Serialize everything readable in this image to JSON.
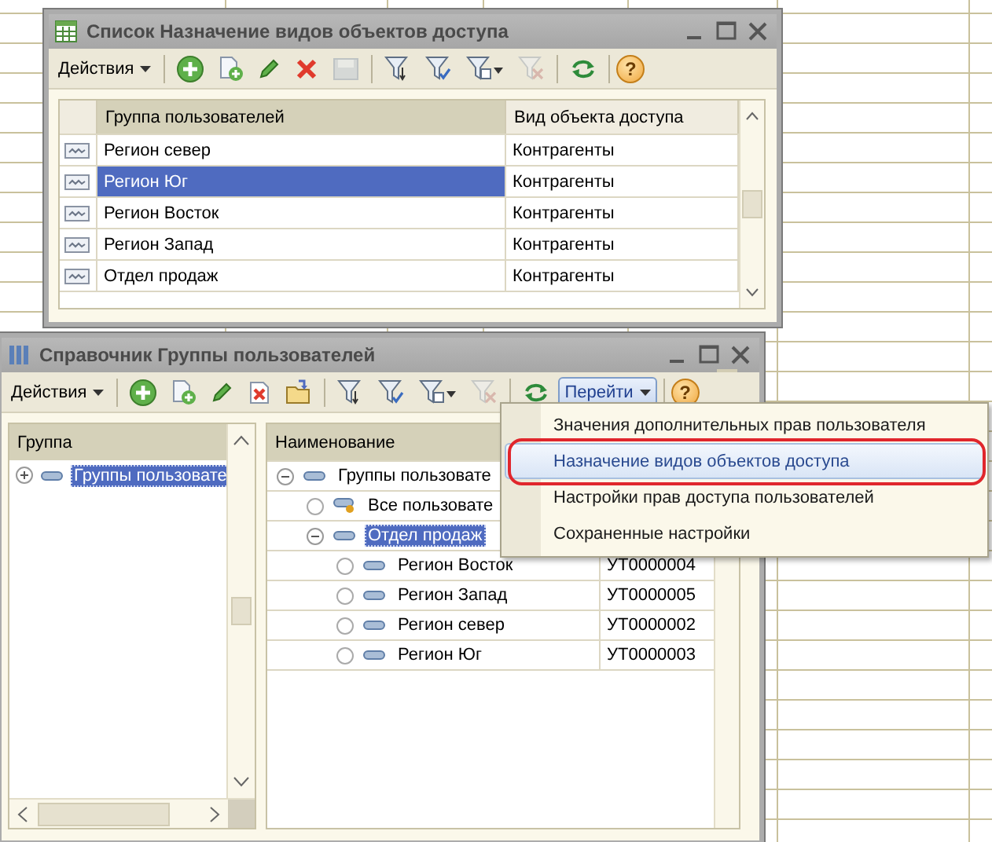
{
  "list_window": {
    "title": "Список Назначение видов объектов доступа",
    "toolbar": [
      {
        "kind": "menu",
        "label": "Действия",
        "pressed": false
      },
      {
        "kind": "separator"
      },
      {
        "kind": "add",
        "disabled": false
      },
      {
        "kind": "copy",
        "disabled": false
      },
      {
        "kind": "edit",
        "disabled": false
      },
      {
        "kind": "delete",
        "disabled": false
      },
      {
        "kind": "save",
        "disabled": true
      },
      {
        "kind": "separator"
      },
      {
        "kind": "filter",
        "disabled": false
      },
      {
        "kind": "filter-check",
        "disabled": false
      },
      {
        "kind": "filter-list",
        "disabled": false
      },
      {
        "kind": "filter-clear",
        "disabled": true
      },
      {
        "kind": "separator"
      },
      {
        "kind": "refresh",
        "disabled": false
      },
      {
        "kind": "separator"
      },
      {
        "kind": "help",
        "label": "?"
      }
    ],
    "table": {
      "columns": [
        {
          "label": "Группа пользователей",
          "sorted": true
        },
        {
          "label": "Вид объекта доступа",
          "sorted": false
        }
      ],
      "rows": [
        {
          "group": "Регион север",
          "type": "Контрагенты",
          "selected": false
        },
        {
          "group": "Регион Юг",
          "type": "Контрагенты",
          "selected": true
        },
        {
          "group": "Регион Восток",
          "type": "Контрагенты",
          "selected": false
        },
        {
          "group": "Регион Запад",
          "type": "Контрагенты",
          "selected": false
        },
        {
          "group": "Отдел продаж",
          "type": "Контрагенты",
          "selected": false
        }
      ]
    }
  },
  "catalog_window": {
    "title": "Справочник Группы пользователей",
    "toolbar": [
      {
        "kind": "menu",
        "label": "Действия",
        "pressed": false
      },
      {
        "kind": "separator"
      },
      {
        "kind": "add",
        "disabled": false
      },
      {
        "kind": "copy",
        "disabled": false
      },
      {
        "kind": "edit",
        "disabled": false
      },
      {
        "kind": "delete-doc",
        "disabled": false
      },
      {
        "kind": "move",
        "disabled": false
      },
      {
        "kind": "separator"
      },
      {
        "kind": "filter",
        "disabled": false
      },
      {
        "kind": "filter-check",
        "disabled": false
      },
      {
        "kind": "filter-list",
        "disabled": false
      },
      {
        "kind": "filter-clear",
        "disabled": true
      },
      {
        "kind": "separator"
      },
      {
        "kind": "refresh",
        "disabled": false
      },
      {
        "kind": "menu",
        "label": "Перейти",
        "pressed": true
      },
      {
        "kind": "separator"
      },
      {
        "kind": "help",
        "label": "?"
      }
    ],
    "group_panel": {
      "column": "Группа",
      "tree": [
        {
          "kind": "group",
          "label": "Группы пользовате",
          "expanded": false,
          "selected": true
        }
      ]
    },
    "list": {
      "columns": [
        {
          "label": "Наименование",
          "sorted": true
        }
      ],
      "rows": [
        {
          "kind": "group",
          "name": "Группы пользовате",
          "expanded": true,
          "selected": false,
          "children": [
            {
              "kind": "all",
              "name": "Все пользовате",
              "selected": false
            },
            {
              "kind": "group",
              "name": "Отдел продаж",
              "expanded": true,
              "selected": true,
              "children": [
                {
                  "kind": "item",
                  "name": "Регион Восток",
                  "code": "УТ0000004",
                  "selected": false
                },
                {
                  "kind": "item",
                  "name": "Регион Запад",
                  "code": "УТ0000005",
                  "selected": false
                },
                {
                  "kind": "item",
                  "name": "Регион север",
                  "code": "УТ0000002",
                  "selected": false
                },
                {
                  "kind": "item",
                  "name": "Регион Юг",
                  "code": "УТ0000003",
                  "selected": false
                }
              ]
            }
          ]
        }
      ]
    }
  },
  "goto_menu": {
    "items": [
      {
        "label": "Значения дополнительных прав пользователя",
        "selected": false
      },
      {
        "label": "Назначение видов объектов доступа",
        "selected": true
      },
      {
        "label": "Настройки прав доступа пользователей",
        "selected": false
      },
      {
        "label": "Сохраненные настройки",
        "selected": false
      }
    ]
  }
}
